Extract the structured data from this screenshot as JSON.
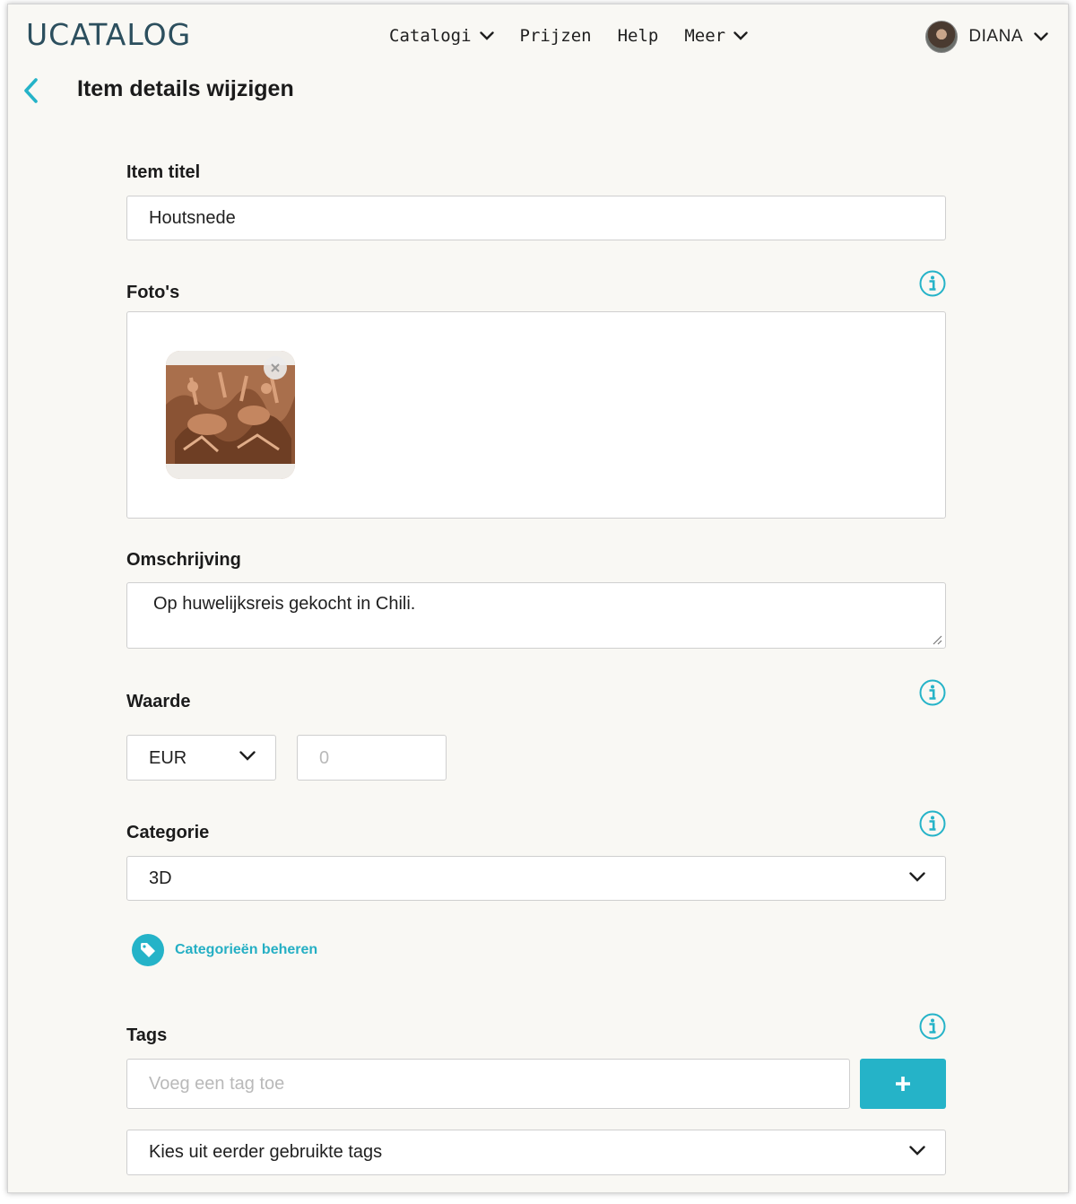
{
  "header": {
    "logo": "UCATALOG",
    "nav": [
      {
        "label": "Catalogi",
        "dropdown": true
      },
      {
        "label": "Prijzen",
        "dropdown": false
      },
      {
        "label": "Help",
        "dropdown": false
      },
      {
        "label": "Meer",
        "dropdown": true
      }
    ],
    "user": {
      "name": "DIANA"
    }
  },
  "page": {
    "title": "Item details wijzigen"
  },
  "form": {
    "title": {
      "label": "Item titel",
      "value": "Houtsnede"
    },
    "photos": {
      "label": "Foto's",
      "items": [
        {
          "alt": "Houtsnede foto"
        }
      ]
    },
    "description": {
      "label": "Omschrijving",
      "value": "Op huwelijksreis gekocht in Chili."
    },
    "value": {
      "label": "Waarde",
      "currency": "EUR",
      "amount_placeholder": "0"
    },
    "category": {
      "label": "Categorie",
      "selected": "3D",
      "manage_label": "Categorieën beheren"
    },
    "tags": {
      "label": "Tags",
      "input_placeholder": "Voeg een tag toe",
      "previous_select": "Kies uit eerder gebruikte tags"
    }
  },
  "colors": {
    "accent": "#25b3c8",
    "logo": "#2c4f5e",
    "background": "#f9f8f4"
  },
  "icons": {
    "back": "chevron-left-icon",
    "dropdown": "chevron-down-icon",
    "info": "info-icon",
    "tag": "tag-icon",
    "add": "plus-icon",
    "remove": "close-icon"
  }
}
